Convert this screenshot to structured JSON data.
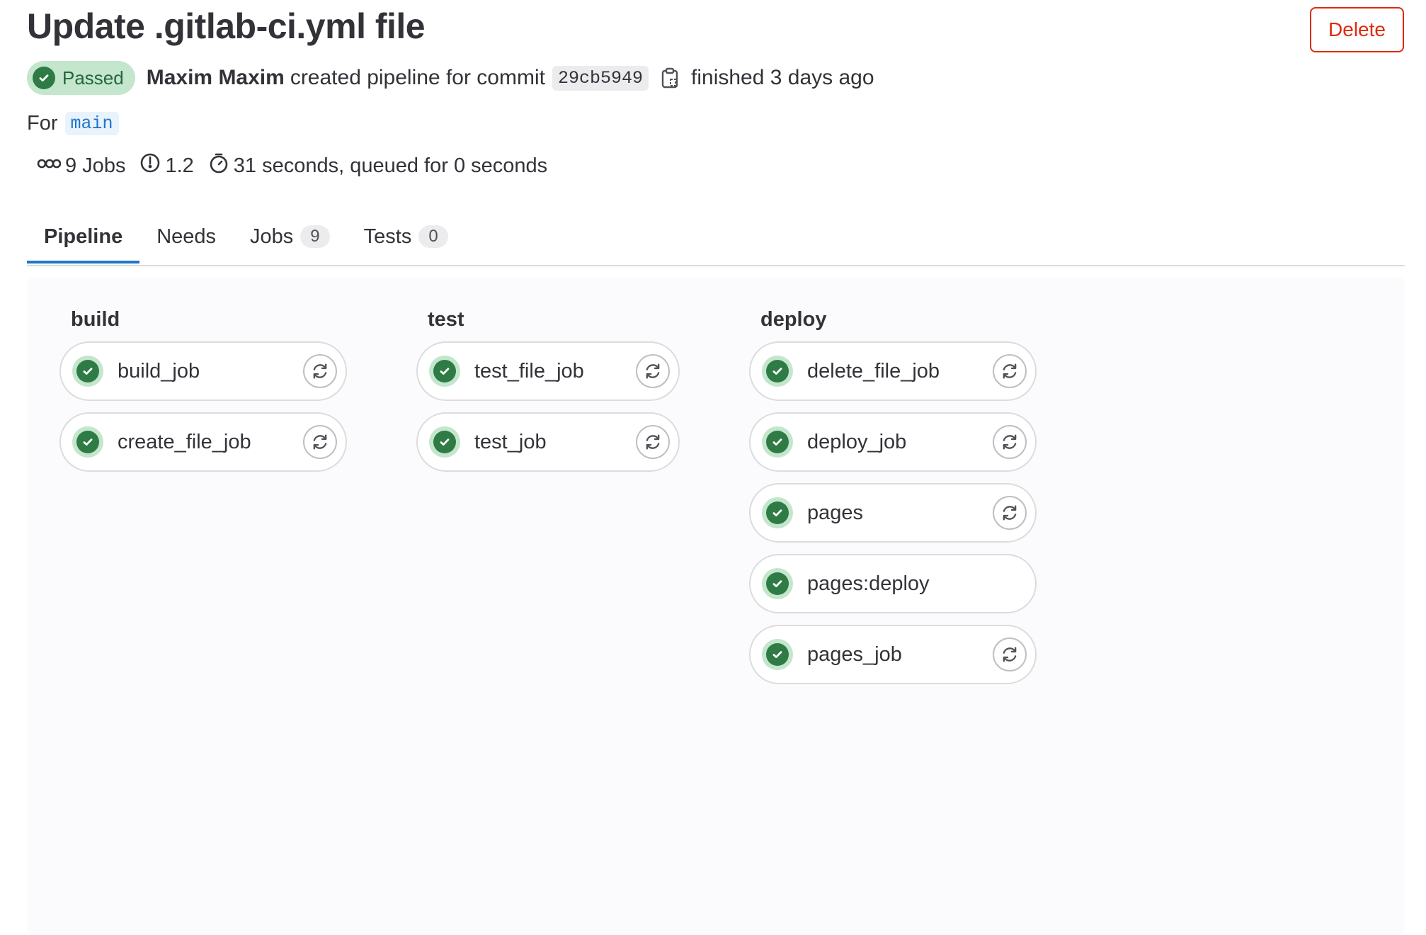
{
  "header": {
    "title": "Update .gitlab-ci.yml file",
    "delete_label": "Delete"
  },
  "meta": {
    "status": "Passed",
    "author": "Maxim Maxim",
    "action_text": "created pipeline for commit",
    "commit_sha": "29cb5949",
    "finished_text": "finished 3 days ago"
  },
  "ref": {
    "prefix": "For",
    "branch": "main"
  },
  "stats": {
    "jobs": "9 Jobs",
    "compute": "1.2",
    "duration": "31 seconds, queued for 0 seconds"
  },
  "tabs": [
    {
      "label": "Pipeline",
      "count": null
    },
    {
      "label": "Needs",
      "count": null
    },
    {
      "label": "Jobs",
      "count": "9"
    },
    {
      "label": "Tests",
      "count": "0"
    }
  ],
  "stages": [
    {
      "name": "build",
      "jobs": [
        {
          "name": "build_job",
          "retry": true
        },
        {
          "name": "create_file_job",
          "retry": true
        }
      ]
    },
    {
      "name": "test",
      "jobs": [
        {
          "name": "test_file_job",
          "retry": true
        },
        {
          "name": "test_job",
          "retry": true
        }
      ]
    },
    {
      "name": "deploy",
      "jobs": [
        {
          "name": "delete_file_job",
          "retry": true
        },
        {
          "name": "deploy_job",
          "retry": true
        },
        {
          "name": "pages",
          "retry": true
        },
        {
          "name": "pages:deploy",
          "retry": false
        },
        {
          "name": "pages_job",
          "retry": true
        }
      ]
    }
  ],
  "colors": {
    "success": "#2f7b45",
    "success_bg": "#c3e6cd",
    "danger": "#dd2b0e",
    "link": "#1f75cb"
  }
}
